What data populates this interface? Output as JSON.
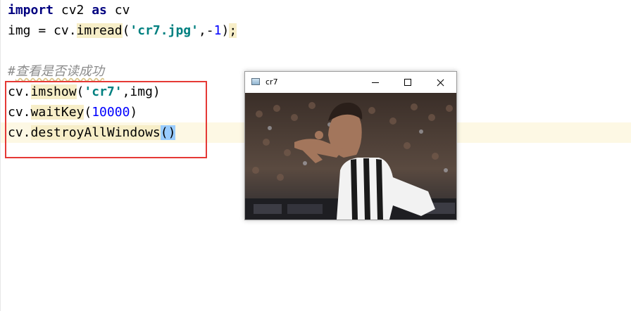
{
  "code": {
    "line1": {
      "kw_import": "import",
      "mod": " cv2 ",
      "kw_as": "as",
      "alias": " cv"
    },
    "line2": {
      "prefix": "img = cv.",
      "fn": "imread",
      "open": "(",
      "str": "'cr7.jpg'",
      "sep": ",-",
      "num": "1",
      "close": ")",
      "semi": ";"
    },
    "line4": {
      "comment_hash": "#",
      "comment_text": "查看是否读成功"
    },
    "line5": {
      "prefix": "cv.",
      "fn": "imshow",
      "open": "(",
      "str": "'cr7'",
      "rest": ",img)"
    },
    "line6": {
      "prefix": "cv.",
      "fn": "waitKey",
      "open": "(",
      "num": "10000",
      "close": ")"
    },
    "line7": {
      "prefix": "cv.",
      "fn": "destroyAllWindows",
      "parens": "()"
    }
  },
  "cv_window": {
    "title": "cr7",
    "icons": {
      "app": "opencv-window-icon",
      "minimize": "minimize-icon",
      "maximize": "maximize-icon",
      "close": "close-icon"
    }
  },
  "colors": {
    "keyword": "#000080",
    "string": "#008080",
    "number": "#0000ff",
    "comment": "#8c8c8c",
    "highlight_box": "#e53935",
    "current_line": "#fdf8e4"
  }
}
